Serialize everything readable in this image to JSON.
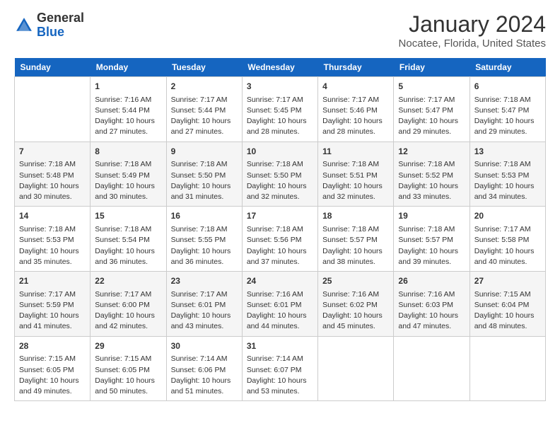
{
  "header": {
    "logo_general": "General",
    "logo_blue": "Blue",
    "month_title": "January 2024",
    "subtitle": "Nocatee, Florida, United States"
  },
  "days_of_week": [
    "Sunday",
    "Monday",
    "Tuesday",
    "Wednesday",
    "Thursday",
    "Friday",
    "Saturday"
  ],
  "weeks": [
    [
      {
        "day": "",
        "info": ""
      },
      {
        "day": "1",
        "info": "Sunrise: 7:16 AM\nSunset: 5:44 PM\nDaylight: 10 hours\nand 27 minutes."
      },
      {
        "day": "2",
        "info": "Sunrise: 7:17 AM\nSunset: 5:44 PM\nDaylight: 10 hours\nand 27 minutes."
      },
      {
        "day": "3",
        "info": "Sunrise: 7:17 AM\nSunset: 5:45 PM\nDaylight: 10 hours\nand 28 minutes."
      },
      {
        "day": "4",
        "info": "Sunrise: 7:17 AM\nSunset: 5:46 PM\nDaylight: 10 hours\nand 28 minutes."
      },
      {
        "day": "5",
        "info": "Sunrise: 7:17 AM\nSunset: 5:47 PM\nDaylight: 10 hours\nand 29 minutes."
      },
      {
        "day": "6",
        "info": "Sunrise: 7:18 AM\nSunset: 5:47 PM\nDaylight: 10 hours\nand 29 minutes."
      }
    ],
    [
      {
        "day": "7",
        "info": "Sunrise: 7:18 AM\nSunset: 5:48 PM\nDaylight: 10 hours\nand 30 minutes."
      },
      {
        "day": "8",
        "info": "Sunrise: 7:18 AM\nSunset: 5:49 PM\nDaylight: 10 hours\nand 30 minutes."
      },
      {
        "day": "9",
        "info": "Sunrise: 7:18 AM\nSunset: 5:50 PM\nDaylight: 10 hours\nand 31 minutes."
      },
      {
        "day": "10",
        "info": "Sunrise: 7:18 AM\nSunset: 5:50 PM\nDaylight: 10 hours\nand 32 minutes."
      },
      {
        "day": "11",
        "info": "Sunrise: 7:18 AM\nSunset: 5:51 PM\nDaylight: 10 hours\nand 32 minutes."
      },
      {
        "day": "12",
        "info": "Sunrise: 7:18 AM\nSunset: 5:52 PM\nDaylight: 10 hours\nand 33 minutes."
      },
      {
        "day": "13",
        "info": "Sunrise: 7:18 AM\nSunset: 5:53 PM\nDaylight: 10 hours\nand 34 minutes."
      }
    ],
    [
      {
        "day": "14",
        "info": "Sunrise: 7:18 AM\nSunset: 5:53 PM\nDaylight: 10 hours\nand 35 minutes."
      },
      {
        "day": "15",
        "info": "Sunrise: 7:18 AM\nSunset: 5:54 PM\nDaylight: 10 hours\nand 36 minutes."
      },
      {
        "day": "16",
        "info": "Sunrise: 7:18 AM\nSunset: 5:55 PM\nDaylight: 10 hours\nand 36 minutes."
      },
      {
        "day": "17",
        "info": "Sunrise: 7:18 AM\nSunset: 5:56 PM\nDaylight: 10 hours\nand 37 minutes."
      },
      {
        "day": "18",
        "info": "Sunrise: 7:18 AM\nSunset: 5:57 PM\nDaylight: 10 hours\nand 38 minutes."
      },
      {
        "day": "19",
        "info": "Sunrise: 7:18 AM\nSunset: 5:57 PM\nDaylight: 10 hours\nand 39 minutes."
      },
      {
        "day": "20",
        "info": "Sunrise: 7:17 AM\nSunset: 5:58 PM\nDaylight: 10 hours\nand 40 minutes."
      }
    ],
    [
      {
        "day": "21",
        "info": "Sunrise: 7:17 AM\nSunset: 5:59 PM\nDaylight: 10 hours\nand 41 minutes."
      },
      {
        "day": "22",
        "info": "Sunrise: 7:17 AM\nSunset: 6:00 PM\nDaylight: 10 hours\nand 42 minutes."
      },
      {
        "day": "23",
        "info": "Sunrise: 7:17 AM\nSunset: 6:01 PM\nDaylight: 10 hours\nand 43 minutes."
      },
      {
        "day": "24",
        "info": "Sunrise: 7:16 AM\nSunset: 6:01 PM\nDaylight: 10 hours\nand 44 minutes."
      },
      {
        "day": "25",
        "info": "Sunrise: 7:16 AM\nSunset: 6:02 PM\nDaylight: 10 hours\nand 45 minutes."
      },
      {
        "day": "26",
        "info": "Sunrise: 7:16 AM\nSunset: 6:03 PM\nDaylight: 10 hours\nand 47 minutes."
      },
      {
        "day": "27",
        "info": "Sunrise: 7:15 AM\nSunset: 6:04 PM\nDaylight: 10 hours\nand 48 minutes."
      }
    ],
    [
      {
        "day": "28",
        "info": "Sunrise: 7:15 AM\nSunset: 6:05 PM\nDaylight: 10 hours\nand 49 minutes."
      },
      {
        "day": "29",
        "info": "Sunrise: 7:15 AM\nSunset: 6:05 PM\nDaylight: 10 hours\nand 50 minutes."
      },
      {
        "day": "30",
        "info": "Sunrise: 7:14 AM\nSunset: 6:06 PM\nDaylight: 10 hours\nand 51 minutes."
      },
      {
        "day": "31",
        "info": "Sunrise: 7:14 AM\nSunset: 6:07 PM\nDaylight: 10 hours\nand 53 minutes."
      },
      {
        "day": "",
        "info": ""
      },
      {
        "day": "",
        "info": ""
      },
      {
        "day": "",
        "info": ""
      }
    ]
  ]
}
